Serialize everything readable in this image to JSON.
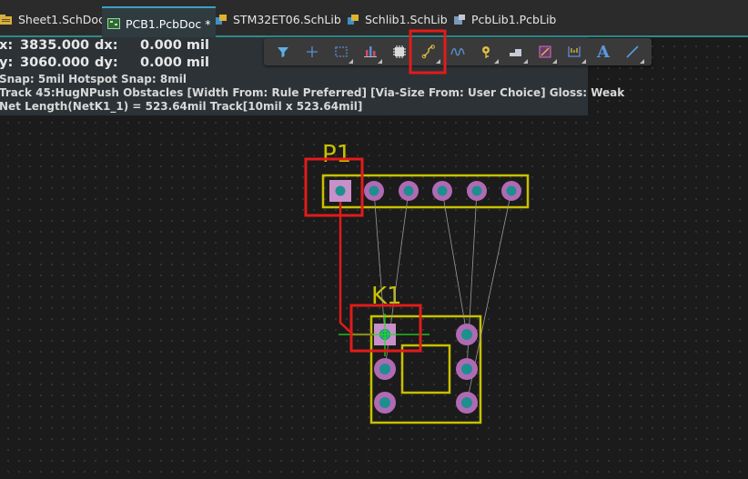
{
  "tabs": [
    {
      "label": "Sheet1.SchDoc",
      "icon": "schdoc-icon",
      "active": false
    },
    {
      "label": "PCB1.PcbDoc *",
      "icon": "pcbdoc-icon",
      "active": true
    },
    {
      "label": "STM32ET06.SchLib",
      "icon": "schlib-icon",
      "active": false
    },
    {
      "label": "Schlib1.SchLib",
      "icon": "schlib-icon",
      "active": false
    },
    {
      "label": "PcbLib1.PcbLib",
      "icon": "pcblib-icon",
      "active": false
    }
  ],
  "hud": {
    "x_label": "x:",
    "x_value": "3835.000",
    "dx_label": "dx:",
    "dx_value": "0.000 mil",
    "y_label": "y:",
    "y_value": "3060.000",
    "dy_label": "dy:",
    "dy_value": "0.000 mil",
    "snap_line": "Snap: 5mil Hotspot Snap: 8mil",
    "track_line": "Track 45:HugNPush Obstacles [Width From: Rule Preferred] [Via-Size From: User Choice] Gloss: Weak",
    "net_line": "Net Length(NetK1_1) = 523.64mil Track[10mil x 523.64mil]"
  },
  "toolbar": {
    "tools": [
      {
        "name": "filter-tool",
        "icon": "filter-icon"
      },
      {
        "name": "crosshair-tool",
        "icon": "plus-icon"
      },
      {
        "name": "select-tool",
        "icon": "dashed-rect-icon"
      },
      {
        "name": "align-tool",
        "icon": "align-icon"
      },
      {
        "name": "component-tool",
        "icon": "chip-icon"
      },
      {
        "name": "route-tool",
        "icon": "route-icon"
      },
      {
        "name": "diff-pair-tool",
        "icon": "wave-icon"
      },
      {
        "name": "via-tool",
        "icon": "via-icon"
      },
      {
        "name": "fill-tool",
        "icon": "fill-icon"
      },
      {
        "name": "region-tool",
        "icon": "region-icon"
      },
      {
        "name": "dimension-tool",
        "icon": "dimension-icon"
      },
      {
        "name": "text-tool",
        "icon": "text-icon"
      },
      {
        "name": "line-tool",
        "icon": "line-icon"
      }
    ],
    "text_tool_glyph": "A"
  },
  "designators": {
    "p1": "P1",
    "k1": "K1"
  },
  "colors": {
    "overlay": "#c8c000",
    "pad_ring": "#b06ab3",
    "pad_center": "#1d8f8f",
    "track": "#e01b1b",
    "ratsnest": "#9a9a9a",
    "highlight": "#e21b1b",
    "cursor": "#22dd22"
  }
}
